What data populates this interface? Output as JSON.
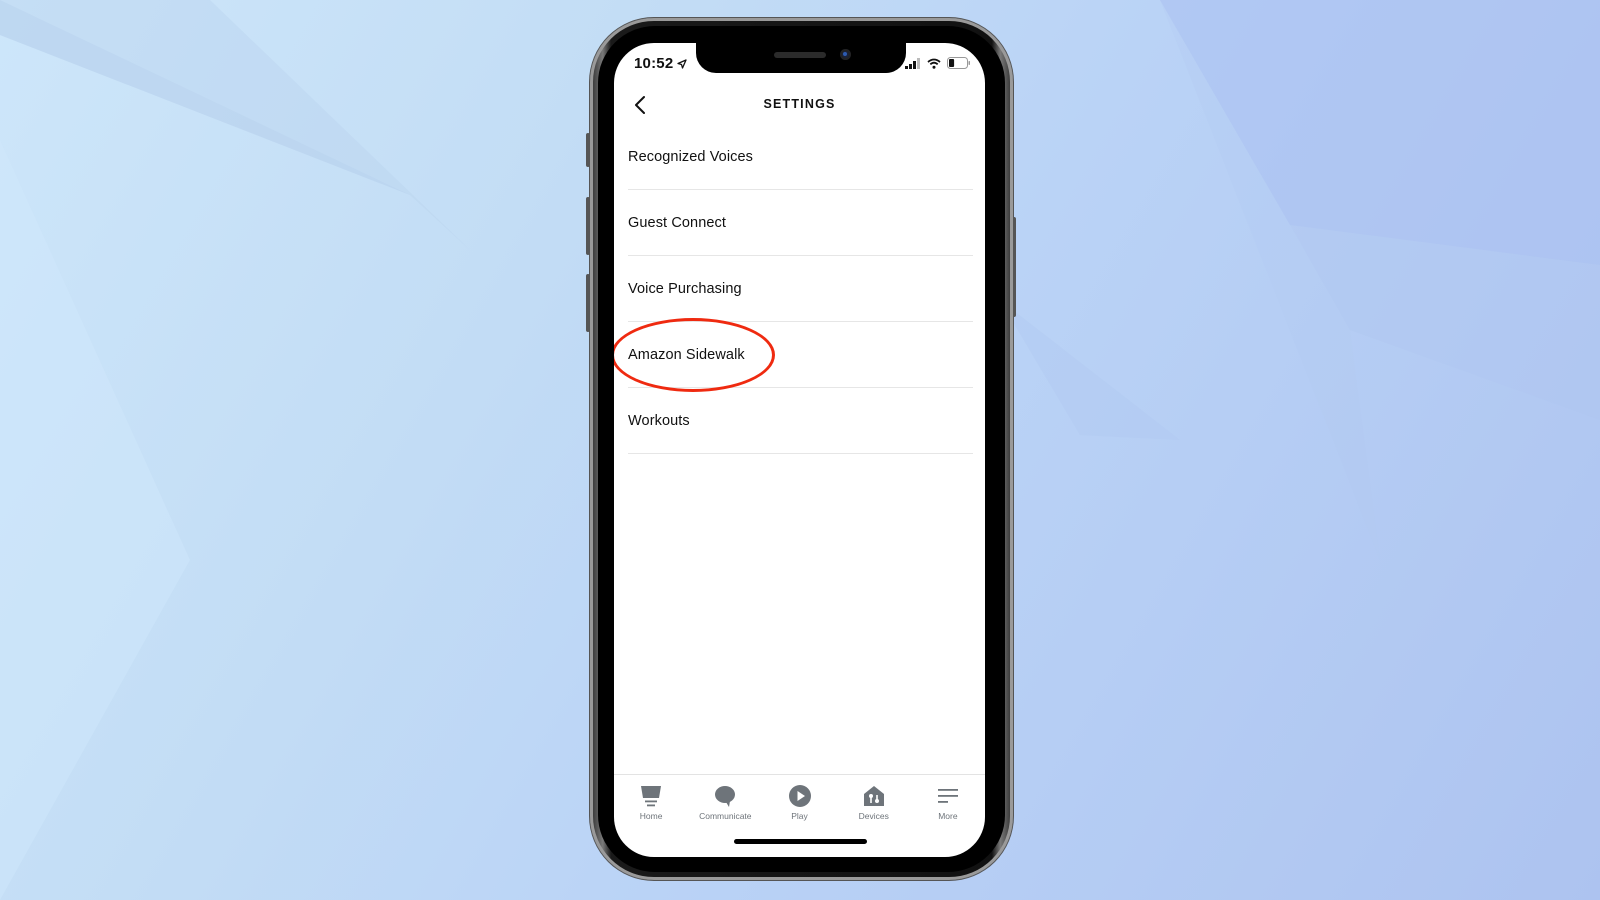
{
  "status_bar": {
    "time": "10:52",
    "location_icon": "location-arrow-icon",
    "signal_icon": "cellular-signal-icon",
    "wifi_icon": "wifi-icon",
    "battery_icon": "battery-icon",
    "battery_level": 0.3
  },
  "nav": {
    "back_icon": "chevron-left-icon",
    "title": "SETTINGS"
  },
  "settings": {
    "items": [
      {
        "label": "Recognized Voices"
      },
      {
        "label": "Guest Connect"
      },
      {
        "label": "Voice Purchasing"
      },
      {
        "label": "Amazon Sidewalk",
        "highlighted": true
      },
      {
        "label": "Workouts"
      }
    ]
  },
  "annotation": {
    "highlight_color": "#ef2a10",
    "highlighted_item": "Amazon Sidewalk"
  },
  "tabbar": {
    "tabs": [
      {
        "label": "Home",
        "icon": "home-echo-icon"
      },
      {
        "label": "Communicate",
        "icon": "chat-bubble-icon"
      },
      {
        "label": "Play",
        "icon": "play-icon"
      },
      {
        "label": "Devices",
        "icon": "devices-house-icon"
      },
      {
        "label": "More",
        "icon": "menu-lines-icon"
      }
    ],
    "icon_color": "#6e747a"
  }
}
